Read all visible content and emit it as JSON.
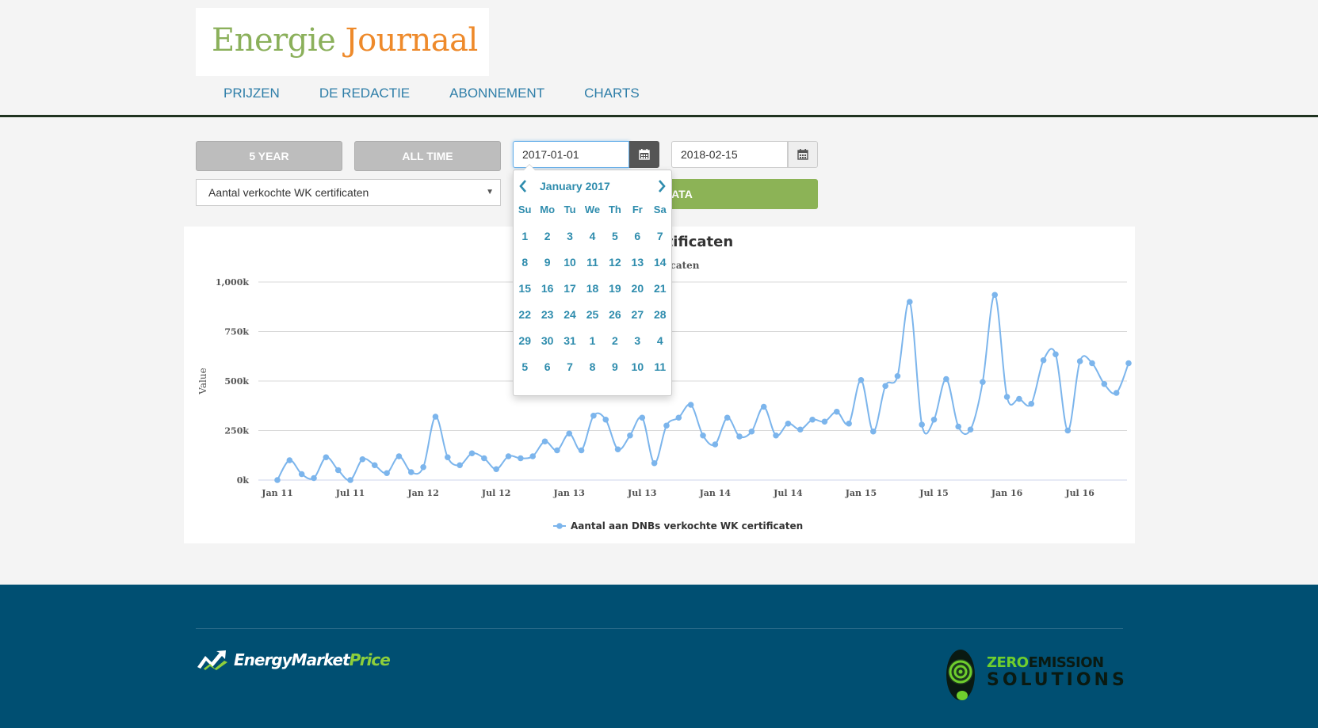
{
  "brand": {
    "logo_word1": "Energie",
    "logo_word2": "Journaal",
    "color_green": "#8bb05b",
    "color_orange": "#ee8a2b"
  },
  "nav": {
    "items": [
      {
        "label": "PRIJZEN"
      },
      {
        "label": "DE REDACTIE"
      },
      {
        "label": "ABONNEMENT"
      },
      {
        "label": "CHARTS"
      }
    ]
  },
  "controls": {
    "btn_5year": "5 YEAR",
    "btn_alltime": "ALL TIME",
    "start_date": "2017-01-01",
    "end_date": "2018-02-15",
    "dataset_select": "Aantal verkochte WK certificaten",
    "update_button": "DATA",
    "accent_green": "#8cb356"
  },
  "datepicker": {
    "title": "January 2017",
    "weekdays": [
      "Su",
      "Mo",
      "Tu",
      "We",
      "Th",
      "Fr",
      "Sa"
    ],
    "weeks": [
      [
        "1",
        "2",
        "3",
        "4",
        "5",
        "6",
        "7"
      ],
      [
        "8",
        "9",
        "10",
        "11",
        "12",
        "13",
        "14"
      ],
      [
        "15",
        "16",
        "17",
        "18",
        "19",
        "20",
        "21"
      ],
      [
        "22",
        "23",
        "24",
        "25",
        "26",
        "27",
        "28"
      ],
      [
        "29",
        "30",
        "31",
        "1",
        "2",
        "3",
        "4"
      ],
      [
        "5",
        "6",
        "7",
        "8",
        "9",
        "10",
        "11"
      ]
    ],
    "prev_icon": "chevron-left-icon",
    "next_icon": "chevron-right-icon",
    "color": "#2e8cad"
  },
  "chart_data": {
    "type": "line",
    "title": "WK certificaten",
    "subtitle": "VK certificaten",
    "ylabel": "Value",
    "xlabel": "",
    "ylim": [
      0,
      1000000
    ],
    "y_ticks": [
      "0k",
      "250k",
      "500k",
      "750k",
      "1,000k"
    ],
    "x_ticks": [
      "Jan 11",
      "Jul 11",
      "Jan 12",
      "Jul 12",
      "Jan 13",
      "Jul 13",
      "Jan 14",
      "Jul 14",
      "Jan 15",
      "Jul 15",
      "Jan 16",
      "Jul 16"
    ],
    "grid": true,
    "legend": "bottom",
    "series": [
      {
        "name": "Aantal aan DNBs verkochte WK certificaten",
        "color": "#7cb5ec",
        "x": [
          "2011-01",
          "2011-02",
          "2011-03",
          "2011-04",
          "2011-05",
          "2011-06",
          "2011-07",
          "2011-08",
          "2011-09",
          "2011-10",
          "2011-11",
          "2011-12",
          "2012-01",
          "2012-02",
          "2012-03",
          "2012-04",
          "2012-05",
          "2012-06",
          "2012-07",
          "2012-08",
          "2012-09",
          "2012-10",
          "2012-11",
          "2012-12",
          "2013-01",
          "2013-02",
          "2013-03",
          "2013-04",
          "2013-05",
          "2013-06",
          "2013-07",
          "2013-08",
          "2013-09",
          "2013-10",
          "2013-11",
          "2013-12",
          "2014-01",
          "2014-02",
          "2014-03",
          "2014-04",
          "2014-05",
          "2014-06",
          "2014-07",
          "2014-08",
          "2014-09",
          "2014-10",
          "2014-11",
          "2014-12",
          "2015-01",
          "2015-02",
          "2015-03",
          "2015-04",
          "2015-05",
          "2015-06",
          "2015-07",
          "2015-08",
          "2015-09",
          "2015-10",
          "2015-11",
          "2015-12",
          "2016-01",
          "2016-02",
          "2016-03",
          "2016-04",
          "2016-05",
          "2016-06",
          "2016-07",
          "2016-08",
          "2016-09",
          "2016-10",
          "2016-11"
        ],
        "values": [
          0,
          100000,
          30000,
          10000,
          115000,
          50000,
          0,
          105000,
          75000,
          35000,
          120000,
          40000,
          65000,
          320000,
          115000,
          75000,
          135000,
          110000,
          55000,
          120000,
          110000,
          120000,
          195000,
          150000,
          235000,
          150000,
          325000,
          305000,
          155000,
          225000,
          315000,
          85000,
          275000,
          315000,
          380000,
          225000,
          180000,
          315000,
          220000,
          245000,
          370000,
          225000,
          285000,
          255000,
          305000,
          295000,
          345000,
          285000,
          505000,
          245000,
          475000,
          525000,
          900000,
          280000,
          305000,
          510000,
          270000,
          255000,
          495000,
          935000,
          420000,
          410000,
          385000,
          605000,
          635000,
          250000,
          600000,
          590000,
          485000,
          440000,
          590000
        ]
      }
    ]
  },
  "footer": {
    "partner1": {
      "name_part1": "EnergyMarket",
      "name_part2": "Price",
      "icon": "chart-arrow-icon"
    },
    "partner2": {
      "line1_a": "ZERO",
      "line1_b": "EMISSION",
      "line2": "SOLUTIONS",
      "icon": "target-globe-icon"
    },
    "background": "#004f72"
  }
}
